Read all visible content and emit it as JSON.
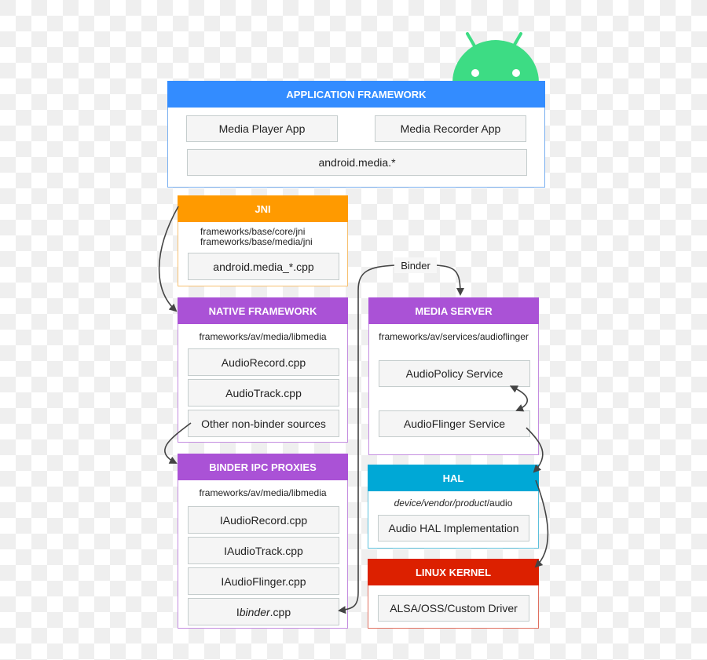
{
  "colors": {
    "app_framework": "#338cff",
    "jni": "#ff9a00",
    "native": "#aa52d6",
    "binder_proxies": "#aa52d6",
    "media_server": "#aa52d6",
    "hal": "#00a8d6",
    "kernel": "#dc2000",
    "android_logo": "#3ddc84"
  },
  "app_framework": {
    "title": "APPLICATION FRAMEWORK",
    "items": [
      "Media Player App",
      "Media Recorder App",
      "android.media.*"
    ]
  },
  "jni": {
    "title": "JNI",
    "paths": [
      "frameworks/base/core/jni",
      "frameworks/base/media/jni"
    ],
    "items": [
      "android.media_*.cpp"
    ]
  },
  "native_framework": {
    "title": "NATIVE FRAMEWORK",
    "path": "frameworks/av/media/libmedia",
    "items": [
      "AudioRecord.cpp",
      "AudioTrack.cpp",
      "Other non-binder sources"
    ]
  },
  "binder_proxies": {
    "title": "BINDER IPC PROXIES",
    "path": "frameworks/av/media/libmedia",
    "items": [
      "IAudioRecord.cpp",
      "IAudioTrack.cpp",
      "IAudioFlinger.cpp"
    ],
    "ibinder": {
      "prefix": "I",
      "italic": "binder",
      "suffix": ".cpp"
    }
  },
  "media_server": {
    "title": "MEDIA SERVER",
    "path": "frameworks/av/services/audioflinger",
    "items": [
      "AudioPolicy Service",
      "AudioFlinger Service"
    ]
  },
  "hal": {
    "title": "HAL",
    "path_italic": "device/vendor/product",
    "path_suffix": "/audio",
    "items": [
      "Audio HAL Implementation"
    ]
  },
  "kernel": {
    "title": "LINUX KERNEL",
    "items": [
      "ALSA/OSS/Custom Driver"
    ]
  },
  "binder_label": "Binder"
}
